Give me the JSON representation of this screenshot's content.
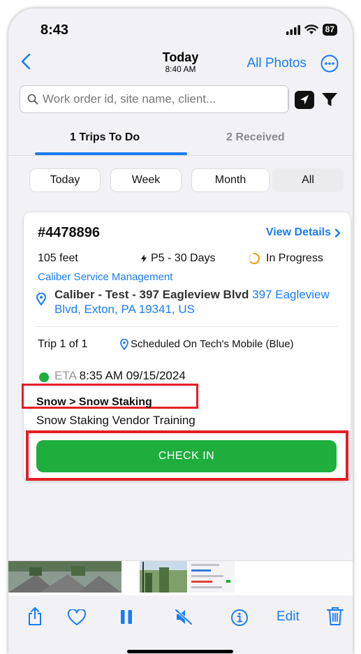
{
  "status_bar": {
    "time": "8:43",
    "battery": "87"
  },
  "nav": {
    "title": "Today",
    "subtitle": "8:40 AM",
    "all_photos": "All Photos"
  },
  "search": {
    "placeholder": "Work order id, site name, client..."
  },
  "tabs": [
    {
      "label": "1 Trips To Do",
      "active": true
    },
    {
      "label": "2 Received",
      "active": false
    }
  ],
  "filters": [
    {
      "label": "Today",
      "selected": false
    },
    {
      "label": "Week",
      "selected": false
    },
    {
      "label": "Month",
      "selected": false
    },
    {
      "label": "All",
      "selected": true
    }
  ],
  "work_order": {
    "number": "#4478896",
    "view_details": "View Details",
    "distance": "105 feet",
    "priority": "P5 - 30 Days",
    "status": "In Progress",
    "client": "Caliber Service Management",
    "site": "Caliber - Test - 397 Eagleview Blvd",
    "address": "397 Eagleview Blvd, Exton, PA 19341, US",
    "trip": "Trip 1 of 1",
    "schedule": "Scheduled On Tech's Mobile (Blue)",
    "eta_label": "ETA",
    "eta": "8:35 AM 09/15/2024",
    "service": "Snow > Snow Staking",
    "description": "Snow Staking Vendor Training",
    "check_in": "CHECK IN"
  },
  "toolbar": {
    "edit": "Edit"
  },
  "colors": {
    "accent": "#1a7cf5",
    "green": "#1fae3e",
    "highlight": "#e41e26"
  }
}
